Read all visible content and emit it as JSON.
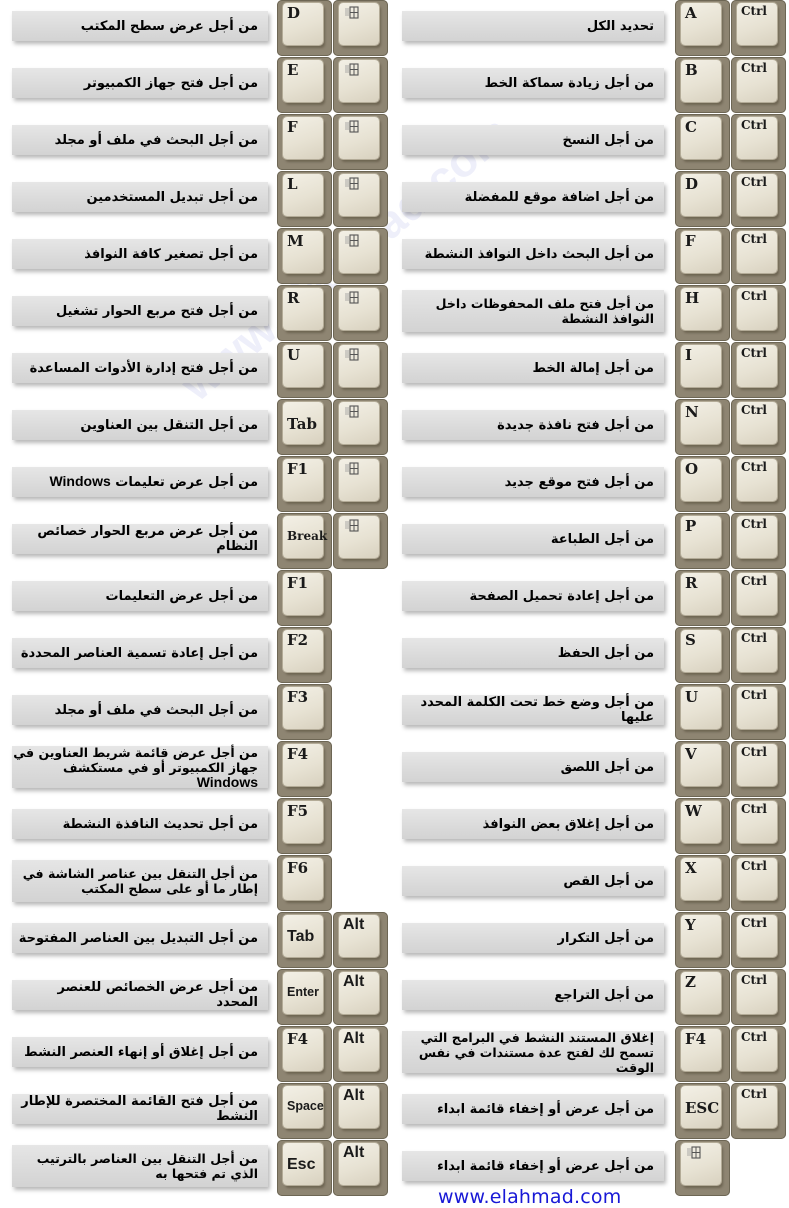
{
  "watermark": "www.elahmad.com",
  "footer_link": "www.elahmad.com",
  "colors": {
    "link": "#1818d6",
    "bar": "#dadada",
    "key": "#e7e2d3"
  },
  "left_column": [
    {
      "desc": "من أجل عرض سطح المكتب",
      "key1": "D",
      "key2": "windows-icon"
    },
    {
      "desc": "من أجل فتح جهاز الكمبيوتر",
      "key1": "E",
      "key2": "windows-icon"
    },
    {
      "desc": "من أجل البحث في ملف أو مجلد",
      "key1": "F",
      "key2": "windows-icon"
    },
    {
      "desc": "من أجل تبديل المستخدمين",
      "key1": "L",
      "key2": "windows-icon"
    },
    {
      "desc": "من أجل تصغير كافة النوافذ",
      "key1": "M",
      "key2": "windows-icon"
    },
    {
      "desc": "من أجل فتح مربع الحوار تشغيل",
      "key1": "R",
      "key2": "windows-icon"
    },
    {
      "desc": "من أجل فتح إدارة الأدوات المساعدة",
      "key1": "U",
      "key2": "windows-icon"
    },
    {
      "desc": "من أجل التنقل بين العناوين",
      "key1": "Tab",
      "key2": "windows-icon"
    },
    {
      "desc": "من أجل عرض تعليمات",
      "desc_latin": "Windows",
      "key1": "F1",
      "key2": "windows-icon"
    },
    {
      "desc": "من أجل عرض مربع الحوار خصائص النظام",
      "key1": "Break",
      "key2": "windows-icon"
    },
    {
      "desc": "من أجل عرض التعليمات",
      "key1": "F1",
      "key2": ""
    },
    {
      "desc": "من أجل إعادة تسمية العناصر المحددة",
      "key1": "F2",
      "key2": ""
    },
    {
      "desc": "من أجل البحث في ملف أو مجلد",
      "key1": "F3",
      "key2": ""
    },
    {
      "desc": "من أجل عرض قائمة شريط العناوين في جهاز الكمبيوتر أو في مستكشف",
      "desc_latin": "Windows",
      "key1": "F4",
      "key2": ""
    },
    {
      "desc": "من أجل تحديث النافذة النشطة",
      "key1": "F5",
      "key2": ""
    },
    {
      "desc": "من أجل التنقل بين عناصر الشاشة في إطار ما أو على سطح المكتب",
      "key1": "F6",
      "key2": ""
    },
    {
      "desc": "من أجل التبديل بين العناصر المفتوحة",
      "key1": "Tab",
      "key2": "Alt"
    },
    {
      "desc": "من أجل عرض الخصائص للعنصر المحدد",
      "key1": "Enter",
      "key2": "Alt"
    },
    {
      "desc": "من أجل إغلاق أو إنهاء العنصر النشط",
      "key1": "F4",
      "key2": "Alt"
    },
    {
      "desc": "من أجل فتح القائمة المختصرة للإطار النشط",
      "key1": "Space",
      "key2": "Alt"
    },
    {
      "desc": "من أجل التنقل بين العناصر بالترتيب الذي تم فتحها به",
      "key1": "Esc",
      "key2": "Alt"
    }
  ],
  "right_column": [
    {
      "desc": "تحديد الكل",
      "key1": "A",
      "key2": "Ctrl"
    },
    {
      "desc": "من أجل زيادة سماكة الخط",
      "key1": "B",
      "key2": "Ctrl"
    },
    {
      "desc": "من أجل النسخ",
      "key1": "C",
      "key2": "Ctrl"
    },
    {
      "desc": "من أجل اضافة موقع للمفضلة",
      "key1": "D",
      "key2": "Ctrl"
    },
    {
      "desc": "من أجل البحث داخل النوافذ النشطة",
      "key1": "F",
      "key2": "Ctrl"
    },
    {
      "desc": "من أجل فتح ملف المحفوظات داخل النوافذ النشطة",
      "key1": "H",
      "key2": "Ctrl"
    },
    {
      "desc": "من أجل إمالة الخط",
      "key1": "I",
      "key2": "Ctrl"
    },
    {
      "desc": "من أجل فتح نافذة جديدة",
      "key1": "N",
      "key2": "Ctrl"
    },
    {
      "desc": "من أجل فتح موقع جديد",
      "key1": "O",
      "key2": "Ctrl"
    },
    {
      "desc": "من أجل الطباعة",
      "key1": "P",
      "key2": "Ctrl"
    },
    {
      "desc": "من أجل إعادة تحميل الصفحة",
      "key1": "R",
      "key2": "Ctrl"
    },
    {
      "desc": "من أجل الحفظ",
      "key1": "S",
      "key2": "Ctrl"
    },
    {
      "desc": "من أجل وضع خط تحت الكلمة المحدد عليها",
      "key1": "U",
      "key2": "Ctrl"
    },
    {
      "desc": "من أجل اللصق",
      "key1": "V",
      "key2": "Ctrl"
    },
    {
      "desc": "من أجل إغلاق بعض النوافذ",
      "key1": "W",
      "key2": "Ctrl"
    },
    {
      "desc": "من أجل القص",
      "key1": "X",
      "key2": "Ctrl"
    },
    {
      "desc": "من أجل التكرار",
      "key1": "Y",
      "key2": "Ctrl"
    },
    {
      "desc": "من أجل التراجع",
      "key1": "Z",
      "key2": "Ctrl"
    },
    {
      "desc": "إغلاق المستند النشط في البرامج التي تسمح لك لفتح عدة مستندات في نفس الوقت",
      "key1": "F4",
      "key2": "Ctrl"
    },
    {
      "desc": "من أجل عرض أو إخفاء قائمة ابداء",
      "key1": "ESC",
      "key2": "Ctrl"
    },
    {
      "desc": "من أجل عرض أو إخفاء قائمة ابداء",
      "key1": "windows-icon",
      "key2": ""
    }
  ]
}
